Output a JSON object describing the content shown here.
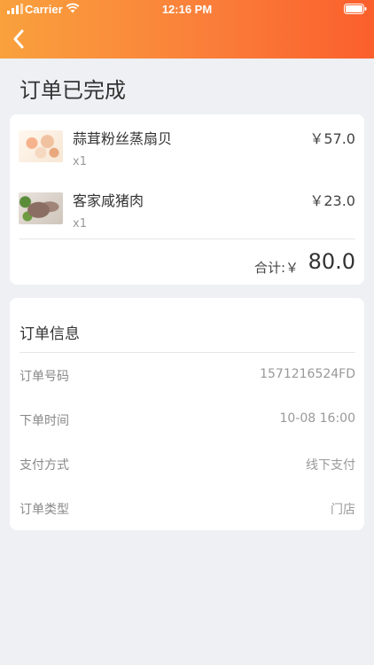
{
  "status_bar": {
    "carrier": "Carrier",
    "time": "12:16 PM"
  },
  "header": {
    "back_icon": "chevron-left-icon",
    "accent": "#fa7f3a"
  },
  "page": {
    "title": "订单已完成"
  },
  "order": {
    "items": [
      {
        "name": "蒜茸粉丝蒸扇贝",
        "qty": "x1",
        "price": "￥57.0"
      },
      {
        "name": "客家咸猪肉",
        "qty": "x1",
        "price": "￥23.0"
      }
    ],
    "total_label": "合计:￥",
    "total_value": "80.0"
  },
  "info": {
    "title": "订单信息",
    "rows": [
      {
        "label": "订单号码",
        "value": "1571216524FD"
      },
      {
        "label": "下单时间",
        "value": "10-08 16:00"
      },
      {
        "label": "支付方式",
        "value": "线下支付"
      },
      {
        "label": "订单类型",
        "value": "门店"
      }
    ]
  }
}
